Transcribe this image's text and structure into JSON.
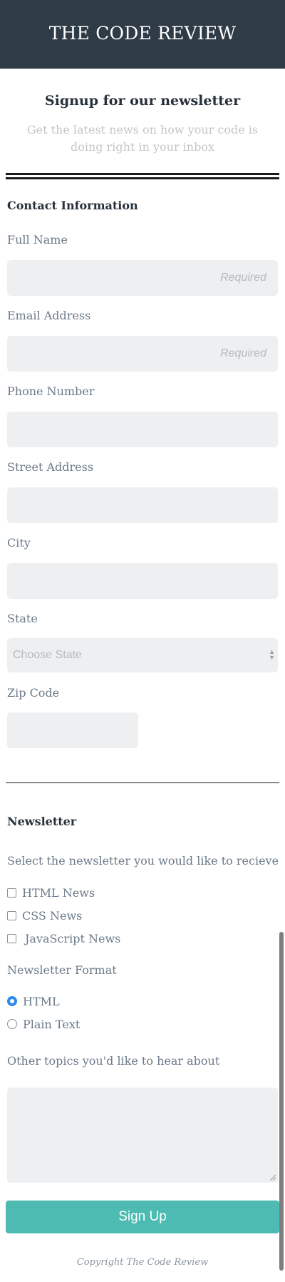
{
  "header": {
    "title": "THE CODE REVIEW"
  },
  "intro": {
    "title": "Signup for our newsletter",
    "subtitle": "Get the latest news on how your code is doing right in your inbox"
  },
  "contact": {
    "section_title": "Contact Information",
    "full_name": {
      "label": "Full Name",
      "placeholder": "Required",
      "value": ""
    },
    "email": {
      "label": "Email Address",
      "placeholder": "Required",
      "value": ""
    },
    "phone": {
      "label": "Phone Number",
      "value": ""
    },
    "street": {
      "label": "Street Address",
      "value": ""
    },
    "city": {
      "label": "City",
      "value": ""
    },
    "state": {
      "label": "State",
      "selected": "Choose State"
    },
    "zip": {
      "label": "Zip Code",
      "value": ""
    }
  },
  "newsletter": {
    "section_title": "Newsletter",
    "select_prompt": "Select the newsletter you would like to recieve",
    "options": [
      {
        "label": "HTML News",
        "checked": false
      },
      {
        "label": "CSS News",
        "checked": false
      },
      {
        "label": "JavaScript News",
        "checked": false
      }
    ],
    "format_label": "Newsletter Format",
    "formats": [
      {
        "label": "HTML",
        "selected": true
      },
      {
        "label": "Plain Text",
        "selected": false
      }
    ],
    "topics_label": "Other topics you'd like to hear about",
    "topics_value": ""
  },
  "actions": {
    "signup_label": "Sign Up"
  },
  "footer": {
    "copyright": "Copyright The Code Review"
  },
  "colors": {
    "header_bg": "#2f3b47",
    "button_bg": "#4dbbb1",
    "field_bg": "#eeeff0",
    "radio_accent": "#2f88f0"
  }
}
